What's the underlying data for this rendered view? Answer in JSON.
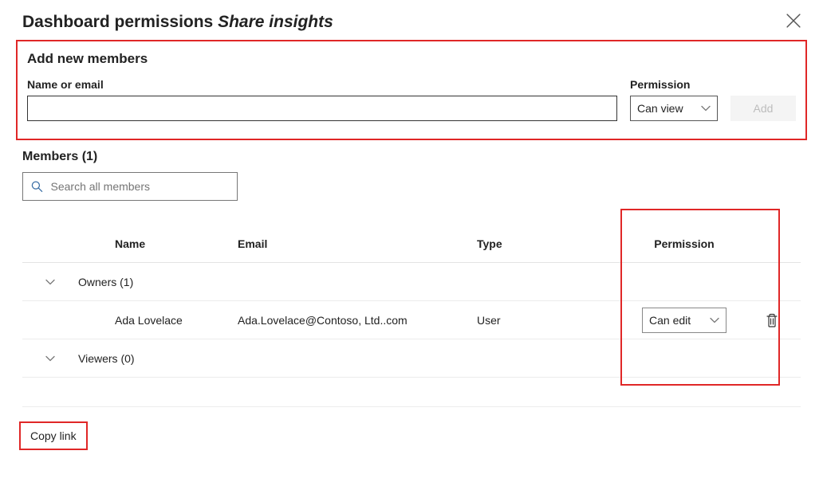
{
  "header": {
    "title": "Dashboard permissions",
    "subtitle": "Share insights",
    "closeIcon": "close"
  },
  "addSection": {
    "heading": "Add new members",
    "nameFieldLabel": "Name or email",
    "nameFieldValue": "",
    "permissionLabel": "Permission",
    "permissionSelected": "Can view",
    "addButtonLabel": "Add"
  },
  "members": {
    "headingPrefix": "Members",
    "count": 1,
    "searchPlaceholder": "Search all members",
    "columns": {
      "name": "Name",
      "email": "Email",
      "type": "Type",
      "permission": "Permission"
    },
    "groups": {
      "owners": {
        "label": "Owners",
        "count": 1
      },
      "viewers": {
        "label": "Viewers",
        "count": 0
      }
    },
    "rows": [
      {
        "name": "Ada Lovelace",
        "email": "Ada.Lovelace@Contoso, Ltd..com",
        "type": "User",
        "permission": "Can edit"
      }
    ]
  },
  "footer": {
    "copyLinkLabel": "Copy link"
  }
}
